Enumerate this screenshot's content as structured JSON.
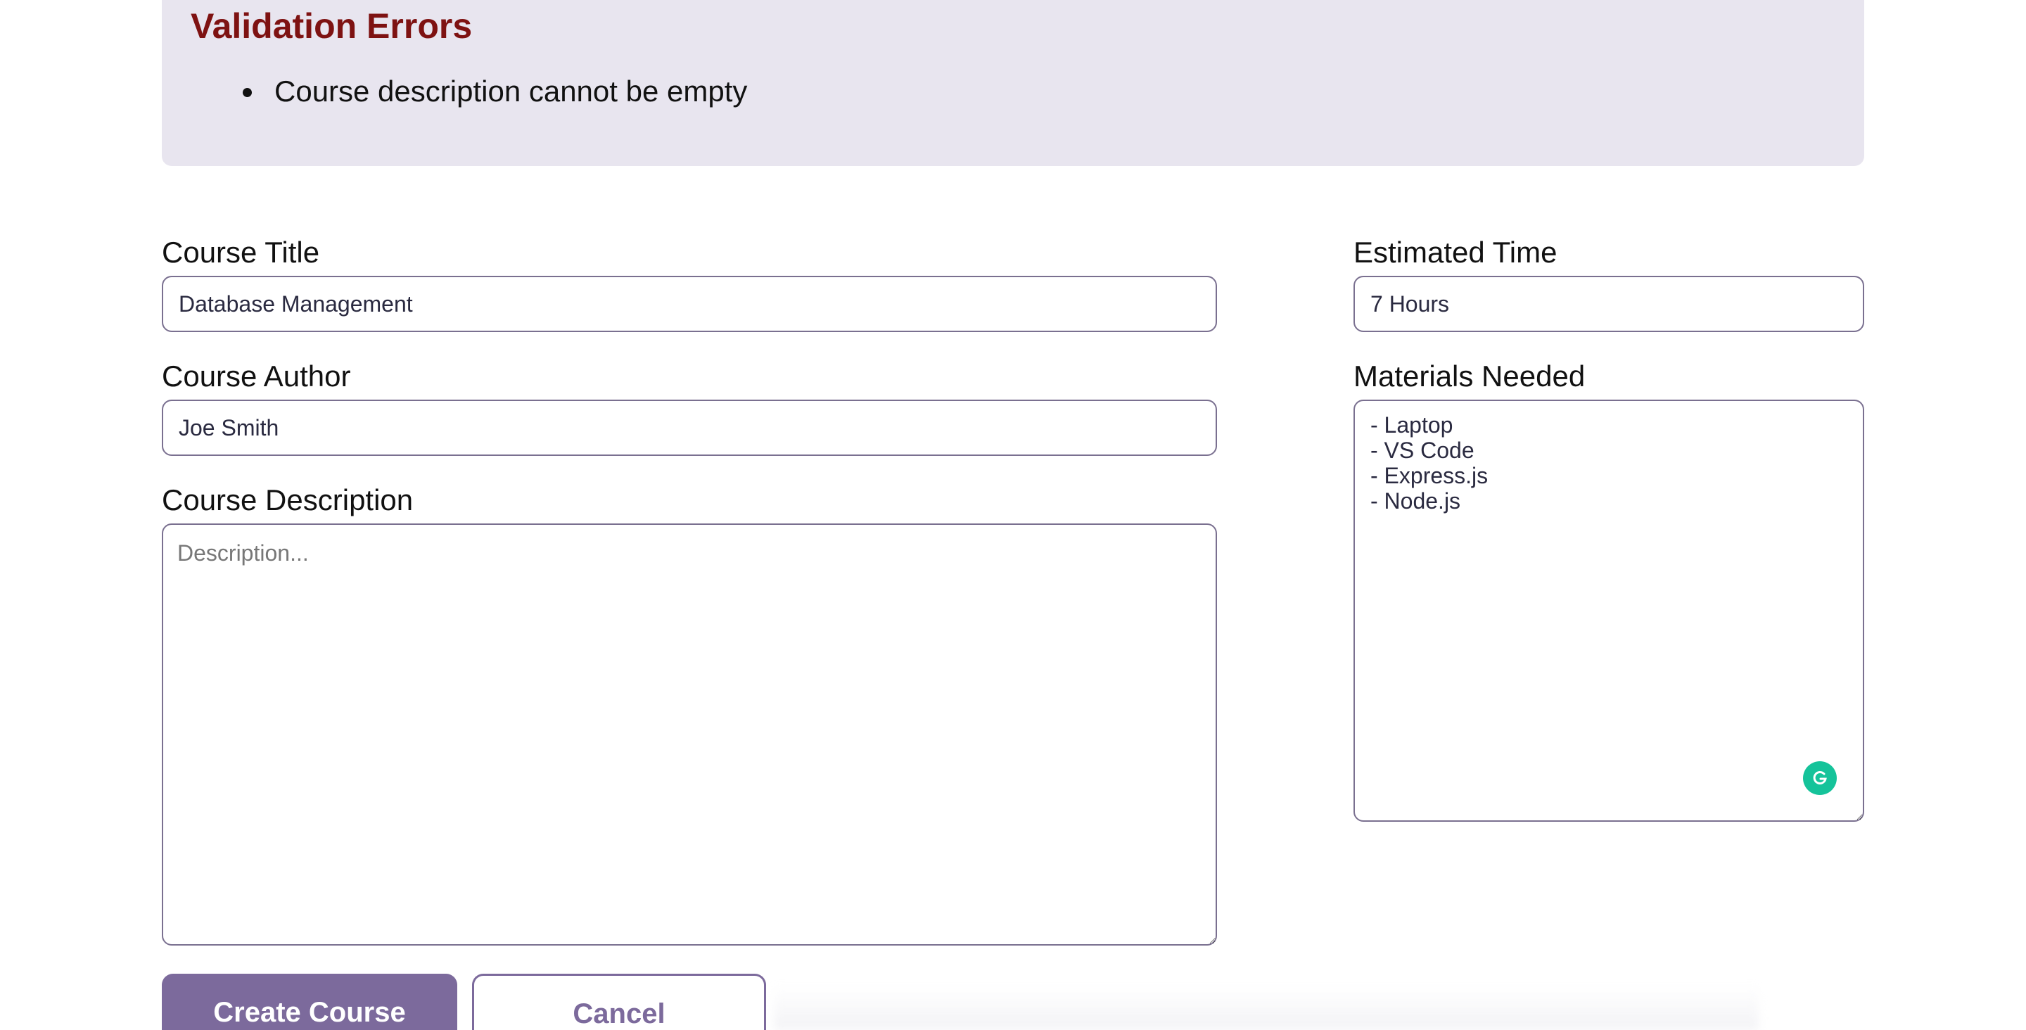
{
  "errors": {
    "title": "Validation Errors",
    "items": [
      {
        "text": "Course description cannot be empty"
      }
    ]
  },
  "form": {
    "title": {
      "label": "Course Title",
      "value": "Database Management"
    },
    "author": {
      "label": "Course Author",
      "value": "Joe Smith"
    },
    "description": {
      "label": "Course Description",
      "value": "",
      "placeholder": "Description..."
    },
    "estimated_time": {
      "label": "Estimated Time",
      "value": "7 Hours"
    },
    "materials": {
      "label": "Materials Needed",
      "lines": [
        "- Laptop",
        "- VS Code",
        "- Express.js",
        "- Node.js"
      ]
    }
  },
  "buttons": {
    "create_label": "Create Course",
    "cancel_label": "Cancel"
  },
  "colors": {
    "error_title": "#7e1212",
    "error_bg": "#e8e5ef",
    "accent": "#7c6a9c",
    "grammarly": "#15c39a"
  },
  "icons": {
    "grammarly": "grammarly-icon"
  }
}
